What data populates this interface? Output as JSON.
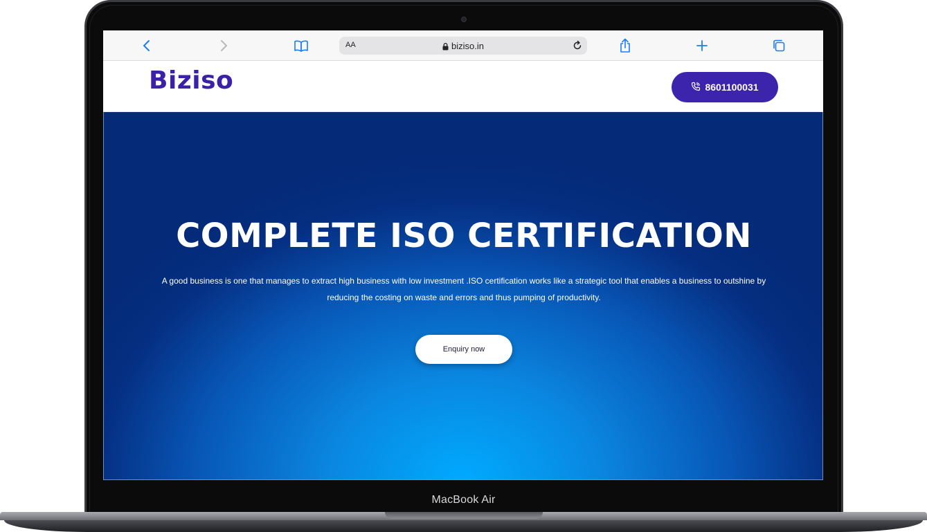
{
  "device": {
    "label": "MacBook Air"
  },
  "browser": {
    "text_size_label": "AA",
    "url": "biziso.in",
    "icons": {
      "back": "chevron-left-icon",
      "forward": "chevron-right-icon",
      "bookmarks": "book-icon",
      "lock": "lock-icon",
      "reload": "reload-icon",
      "share": "share-icon",
      "new_tab": "plus-icon",
      "tabs": "tabs-icon"
    },
    "accent_color": "#1a7cf5"
  },
  "header": {
    "logo_text": "Biziso",
    "phone_button_label": "8601100031",
    "phone_icon": "phone-icon",
    "brand_color": "#3d24ad"
  },
  "hero": {
    "title": "COMPLETE ISO CERTIFICATION",
    "description": "A good business is one that manages to extract high business with low investment .ISO certification works like a strategic tool that enables a business to outshine by reducing the costing on waste and errors and thus pumping of productivity.",
    "cta_label": "Enquiry now",
    "background_colors": [
      "#00aaff",
      "#0857b7",
      "#042a78"
    ]
  }
}
